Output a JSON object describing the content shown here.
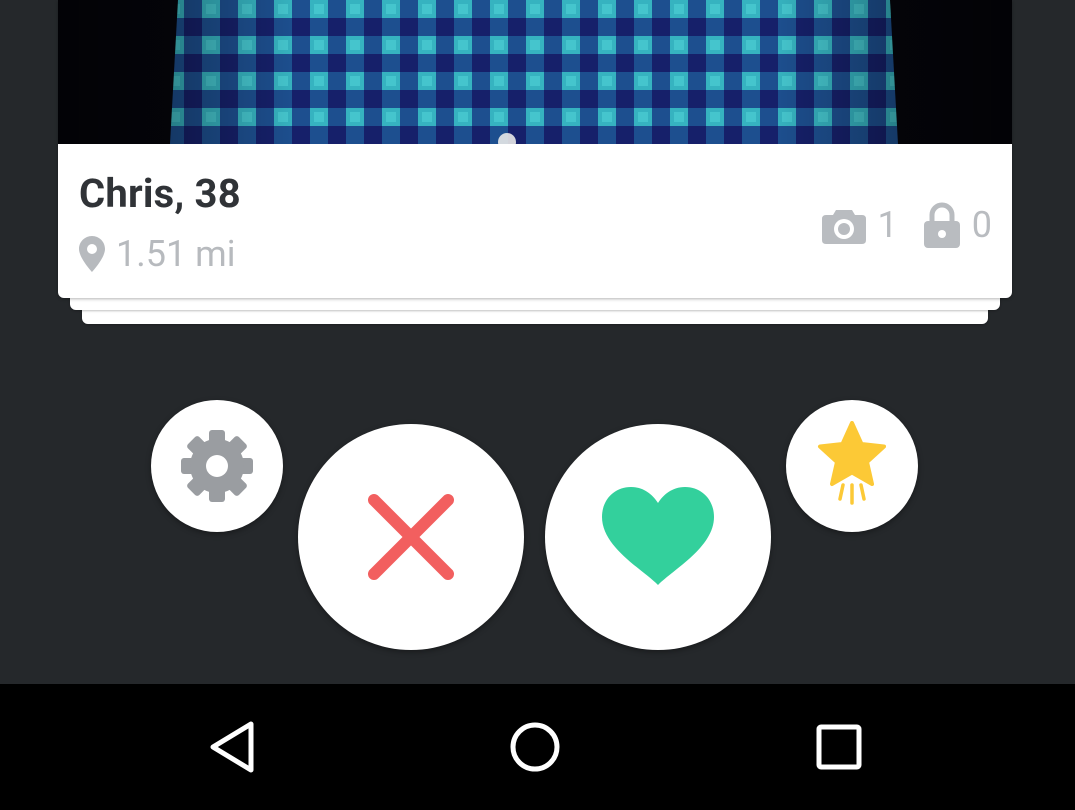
{
  "profile": {
    "name_age": "Chris, 38",
    "distance": "1.51 mi",
    "photo_count": "1",
    "private_photo_count": "0"
  },
  "icons": {
    "location": "map-pin-icon",
    "photos": "camera-icon",
    "private": "lock-icon",
    "settings": "gear-icon",
    "nope": "close-x-icon",
    "like": "heart-icon",
    "super": "star-boost-icon",
    "nav_back": "triangle-back-icon",
    "nav_home": "circle-home-icon",
    "nav_recents": "square-recents-icon"
  },
  "colors": {
    "background": "#25282b",
    "nope": "#f25f5f",
    "like": "#33d09c",
    "super": "#fcc936",
    "muted": "#b9bcc0"
  }
}
